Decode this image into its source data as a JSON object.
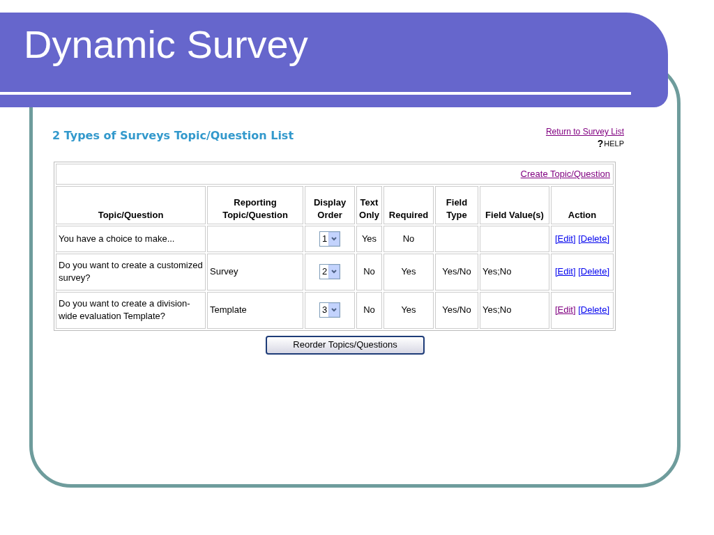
{
  "slide": {
    "title": "Dynamic Survey"
  },
  "page": {
    "heading": "2 Types of Surveys Topic/Question List",
    "return_link": "Return to Survey List",
    "help": {
      "mark": "?",
      "label": "HELP"
    },
    "create_link": "Create Topic/Question",
    "columns": [
      [
        "Topic/Question"
      ],
      [
        "Reporting",
        "Topic/Question"
      ],
      [
        "Display",
        "Order"
      ],
      [
        "Text",
        "Only"
      ],
      [
        "Required"
      ],
      [
        "Field",
        "Type"
      ],
      [
        "Field Value(s)"
      ],
      [
        "Action"
      ]
    ],
    "rows": [
      {
        "question": "You have a choice to make...",
        "reporting": "",
        "order": "1",
        "text_only": "Yes",
        "required": "No",
        "field_type": "",
        "field_values": "",
        "actions": [
          {
            "label": "[Edit]",
            "visited": false
          },
          {
            "label": "[Delete]",
            "visited": false
          }
        ]
      },
      {
        "question": "Do you want to create a customized survey?",
        "reporting": "Survey",
        "order": "2",
        "text_only": "No",
        "required": "Yes",
        "field_type": "Yes/No",
        "field_values": "Yes;No",
        "actions": [
          {
            "label": "[Edit]",
            "visited": false
          },
          {
            "label": "[Delete]",
            "visited": false
          }
        ]
      },
      {
        "question": "Do you want to create a division-wide evaluation Template?",
        "reporting": "Template",
        "order": "3",
        "text_only": "No",
        "required": "Yes",
        "field_type": "Yes/No",
        "field_values": "Yes;No",
        "actions": [
          {
            "label": "[Edit]",
            "visited": true
          },
          {
            "label": "[Delete]",
            "visited": false
          }
        ]
      }
    ],
    "reorder_button": "Reorder Topics/Questions"
  }
}
